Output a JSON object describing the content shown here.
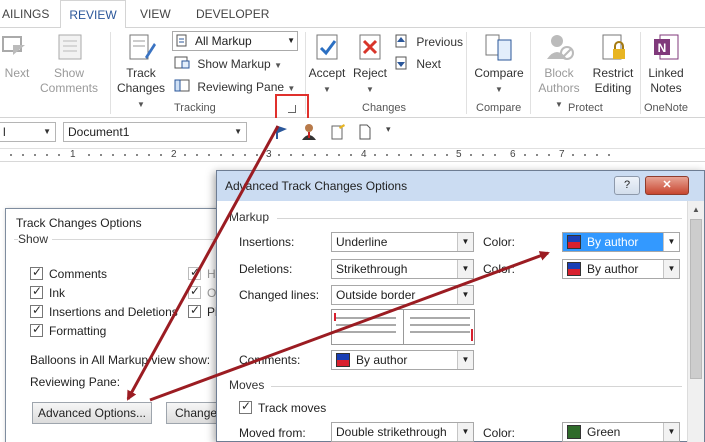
{
  "tabs": [
    "AILINGS",
    "REVIEW",
    "VIEW",
    "DEVELOPER"
  ],
  "ribbon": {
    "next_label": "Next",
    "show_comments_label": [
      "Show",
      "Comments"
    ],
    "track_changes_label": [
      "Track",
      "Changes"
    ],
    "markup_dropdown_value": "All Markup",
    "show_markup_label": "Show Markup",
    "reviewing_pane_label": "Reviewing Pane",
    "tracking_group": "Tracking",
    "accept_label": "Accept",
    "reject_label": "Reject",
    "previous_label": "Previous",
    "next_change_label": "Next",
    "changes_group": "Changes",
    "compare_label": "Compare",
    "compare_group": "Compare",
    "block_authors_label": [
      "Block",
      "Authors"
    ],
    "restrict_editing_label": [
      "Restrict",
      "Editing"
    ],
    "protect_group": "Protect",
    "linked_notes_label": [
      "Linked",
      "Notes"
    ],
    "onenote_group": "OneNote"
  },
  "qbar": {
    "style_combo": "l",
    "document_combo": "Document1"
  },
  "ruler": [
    "1",
    "2",
    "3",
    "4",
    "5",
    "6",
    "7"
  ],
  "track_changes_dialog": {
    "title": "Track Changes Options",
    "show_legend": "Show",
    "checkboxes": [
      "Comments",
      "Ink",
      "Insertions and Deletions",
      "Formatting"
    ],
    "partial_right": [
      "H",
      "O",
      "Pi"
    ],
    "balloons_label": "Balloons in All Markup view show:",
    "reviewing_pane_label": "Reviewing Pane:",
    "advanced_button": "Advanced Options...",
    "change_button": "Change"
  },
  "advanced_dialog": {
    "title": "Advanced Track Changes Options",
    "help_button": "?",
    "close_button": "✕",
    "markup_section": "Markup",
    "insertions_label": "Insertions:",
    "insertions_value": "Underline",
    "deletions_label": "Deletions:",
    "deletions_value": "Strikethrough",
    "changed_lines_label": "Changed lines:",
    "changed_lines_value": "Outside border",
    "comments_label": "Comments:",
    "comments_value": "By author",
    "color_label_1": "Color:",
    "color_value_1": "By author",
    "color_label_2": "Color:",
    "color_value_2": "By author",
    "moves_section": "Moves",
    "track_moves_label": "Track moves",
    "moved_from_label": "Moved from:",
    "moved_from_value": "Double strikethrough",
    "color_label_3": "Color:",
    "color_value_3": "Green"
  },
  "colors": {
    "accent": "#2b579a",
    "highlight_box": "#e0302c",
    "arrow": "#9b1c22",
    "by_author_top": "#1a3fb5",
    "by_author_bottom": "#d8202e",
    "green": "#2f6b2a"
  }
}
